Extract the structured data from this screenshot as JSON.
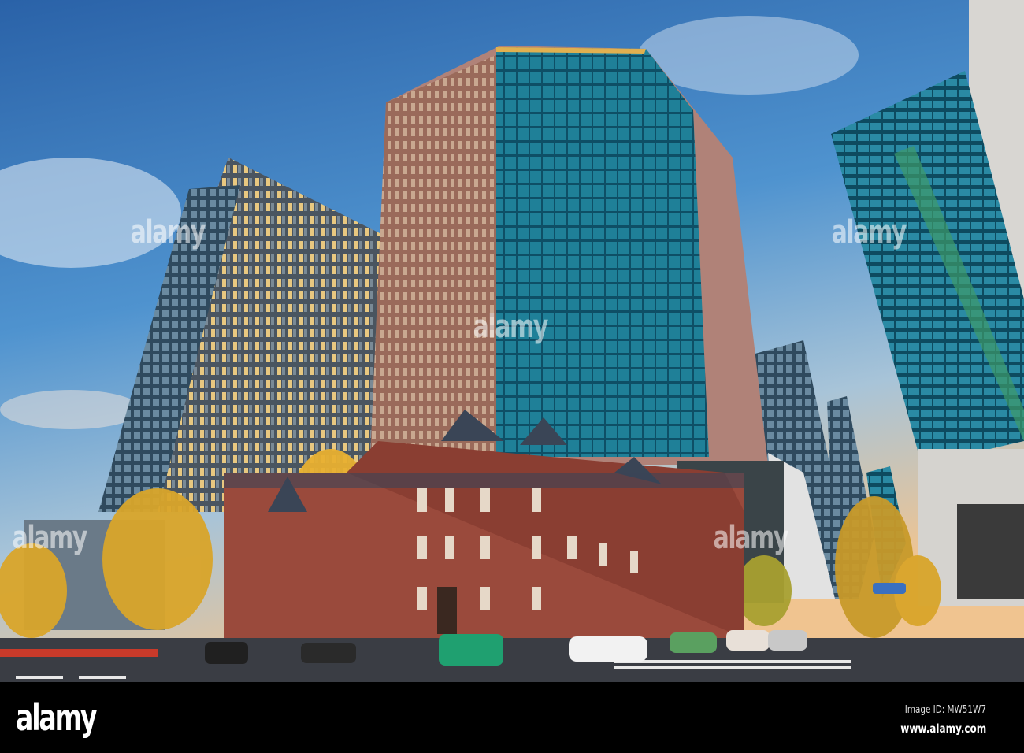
{
  "photo": {
    "subject": "Tokyo office towers and red-brick Mitsubishi Ichigokan building at dusk",
    "colors": {
      "sky_top": "#2b6cae",
      "sky_bottom": "#f2c79a",
      "glass": "#1f6f86",
      "brick": "#9a4a3c",
      "ginkgo": "#d9a52a",
      "road": "#3a3d44"
    }
  },
  "watermark": {
    "text": "alamy"
  },
  "footer": {
    "logo": "alamy",
    "image_id": "Image ID: MW51W7",
    "url": "www.alamy.com"
  }
}
